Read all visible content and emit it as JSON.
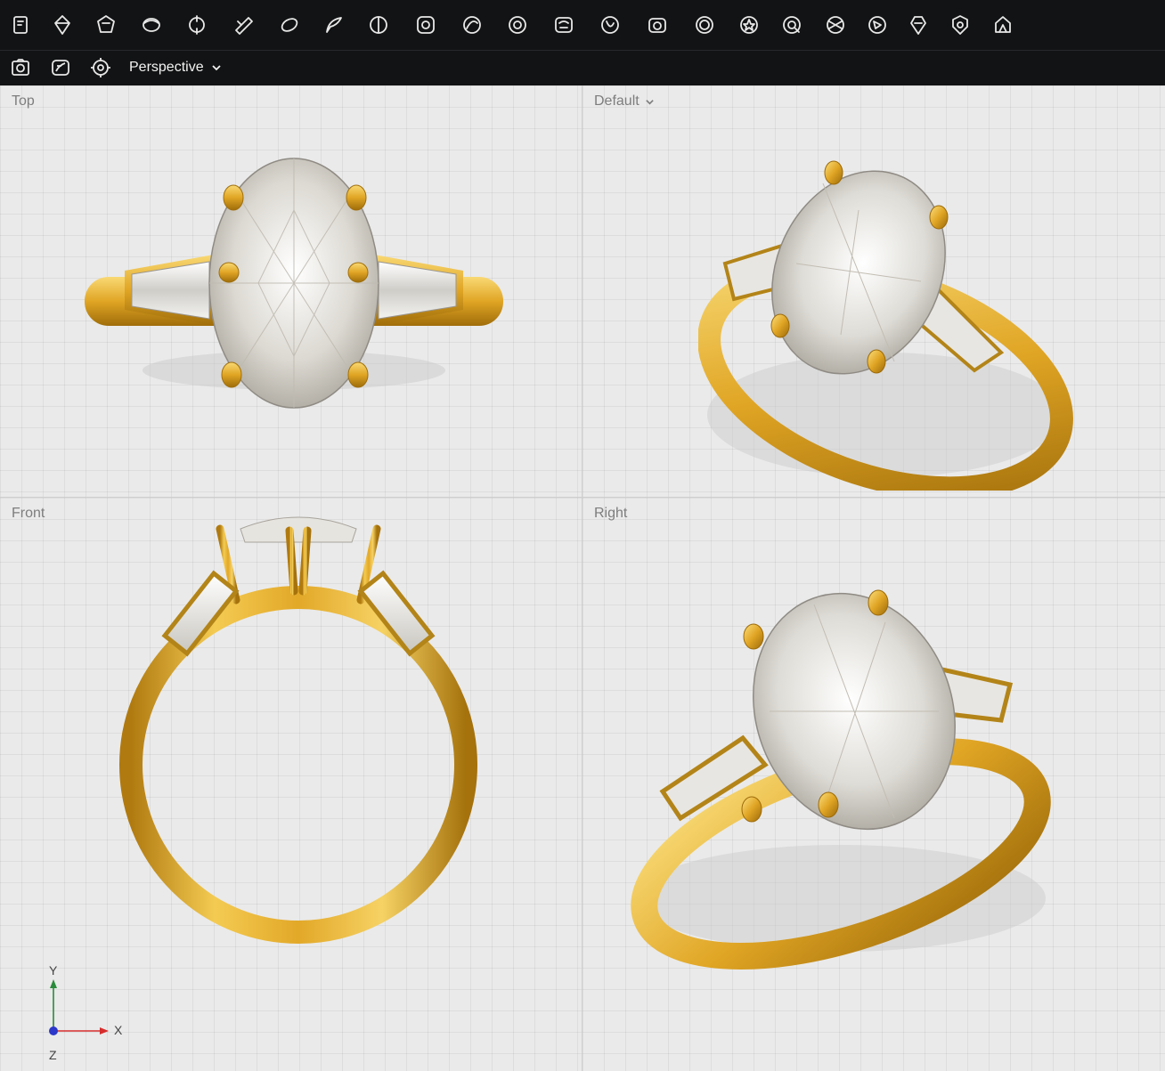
{
  "toolbar": {
    "icons": [
      "select-tool-icon",
      "gem-icon",
      "polygon-tool-icon",
      "shank-icon",
      "prong-head-icon",
      "cut-tool-icon",
      "bezel-icon",
      "sculpt-icon",
      "split-icon",
      "gem-seat-icon",
      "curve-icon",
      "ring-seat-icon",
      "render-settings-icon",
      "rotate-icon",
      "camera-icon",
      "center-stone-icon",
      "star-setting-icon",
      "loupe-icon",
      "faceted-stone-icon",
      "pave-icon",
      "gallery-icon",
      "shield-icon",
      "crown-icon"
    ]
  },
  "view_bar": {
    "snapshot_icon": "camera-icon",
    "render_icon": "render-icon",
    "settings_icon": "gear-camera-icon",
    "projection_label": "Perspective"
  },
  "viewports": {
    "top": {
      "label": "Top"
    },
    "default": {
      "label": "Default"
    },
    "front": {
      "label": "Front"
    },
    "right": {
      "label": "Right"
    }
  },
  "axes": {
    "y": "Y",
    "x": "X",
    "z": "Z"
  },
  "colors": {
    "gold_light": "#f6cf5e",
    "gold_mid": "#e1a928",
    "gold_dark": "#a8740d",
    "axis_x": "#d62d2d",
    "axis_y": "#2a8b3c",
    "axis_z": "#2b38c9"
  }
}
